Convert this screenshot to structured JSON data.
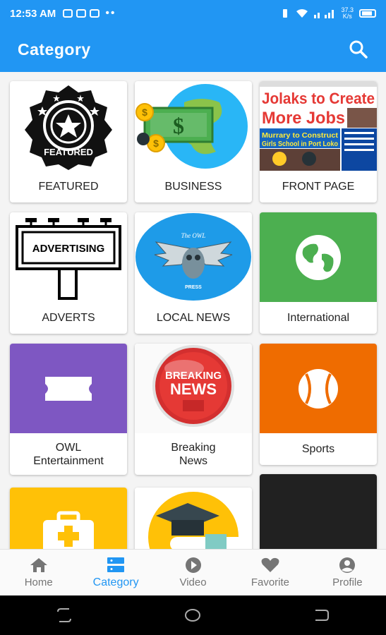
{
  "status_bar": {
    "time": "12:53 AM",
    "speed": "37.3\nK/s",
    "dots": "••"
  },
  "app_bar": {
    "title": "Category",
    "search_icon": "search-icon"
  },
  "colors": {
    "primary": "#2196f3",
    "international": "#4caf50",
    "entertainment": "#7e57c2",
    "sports": "#ef6c00",
    "health": "#ffc107",
    "dark_tile": "#212121"
  },
  "categories": [
    {
      "label": "FEATURED"
    },
    {
      "label": "BUSINESS"
    },
    {
      "label": "FRONT PAGE"
    },
    {
      "label": "ADVERTS"
    },
    {
      "label": "LOCAL NEWS"
    },
    {
      "label": "International"
    },
    {
      "label": "OWL\nEntertainment"
    },
    {
      "label": "Breaking\nNews"
    },
    {
      "label": "Sports"
    }
  ],
  "image_text": {
    "featured": "FEATURED",
    "headline": "Jolaks to Create More Jobs",
    "subhead": "Murrary to Construct Girls School in Port Loko",
    "advertising": "ADVERTISING",
    "owl": "The OWL",
    "press": "PRESS",
    "breaking": "BREAKING",
    "news": "NEWS"
  },
  "bottom_nav": [
    {
      "label": "Home",
      "icon": "home-icon"
    },
    {
      "label": "Category",
      "icon": "category-icon"
    },
    {
      "label": "Video",
      "icon": "play-icon"
    },
    {
      "label": "Favorite",
      "icon": "heart-icon"
    },
    {
      "label": "Profile",
      "icon": "profile-icon"
    }
  ]
}
